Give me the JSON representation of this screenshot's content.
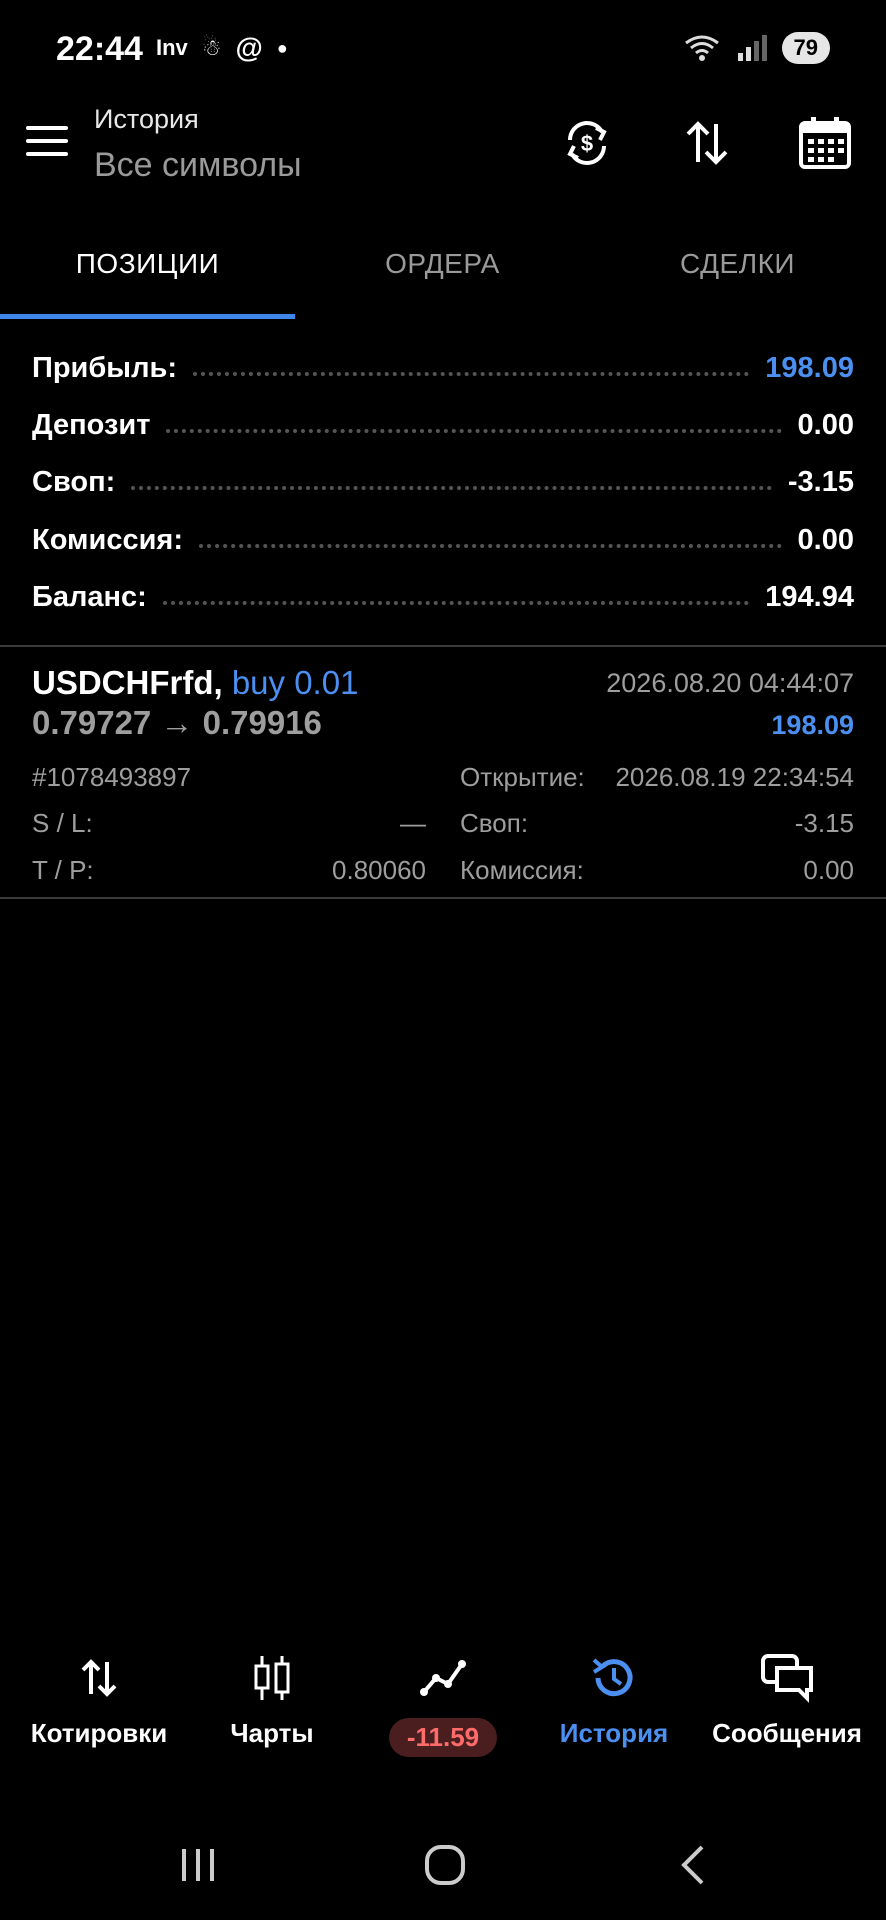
{
  "status_bar": {
    "time": "22:44",
    "notif_1": "Inv",
    "battery": "79"
  },
  "header": {
    "title": "История",
    "subtitle": "Все символы"
  },
  "tabs": [
    {
      "label": "ПОЗИЦИИ",
      "active": true
    },
    {
      "label": "ОРДЕРА",
      "active": false
    },
    {
      "label": "СДЕЛКИ",
      "active": false
    }
  ],
  "summary": [
    {
      "label": "Прибыль:",
      "value": "198.09"
    },
    {
      "label": "Депозит",
      "value": "0.00"
    },
    {
      "label": "Своп:",
      "value": "-3.15"
    },
    {
      "label": "Комиссия:",
      "value": "0.00"
    },
    {
      "label": "Баланс:",
      "value": "194.94"
    }
  ],
  "position": {
    "symbol": "USDCHFrfd,",
    "side": "buy 0.01",
    "prices": "0.79727 → 0.79916",
    "close_time": "2026.08.20 04:44:07",
    "profit": "198.09",
    "ticket": "#1078493897",
    "open_label": "Открытие:",
    "open_time": "2026.08.19 22:34:54",
    "sl_label": "S / L:",
    "sl_value": "—",
    "swap_label": "Своп:",
    "swap_value": "-3.15",
    "tp_label": "T / P:",
    "tp_value": "0.80060",
    "commission_label": "Комиссия:",
    "commission_value": "0.00"
  },
  "bottom_nav": [
    {
      "label": "Котировки",
      "icon": "quotes-arrows-icon"
    },
    {
      "label": "Чарты",
      "icon": "candlesticks-icon"
    },
    {
      "label": "-11.59",
      "icon": "trade-line-icon"
    },
    {
      "label": "История",
      "icon": "history-clock-icon",
      "active": true
    },
    {
      "label": "Сообщения",
      "icon": "messages-icon"
    }
  ],
  "colors": {
    "accent": "#4b8ff0",
    "loss": "#ff6b6b",
    "background": "#000000",
    "muted": "#9e9e9e"
  }
}
